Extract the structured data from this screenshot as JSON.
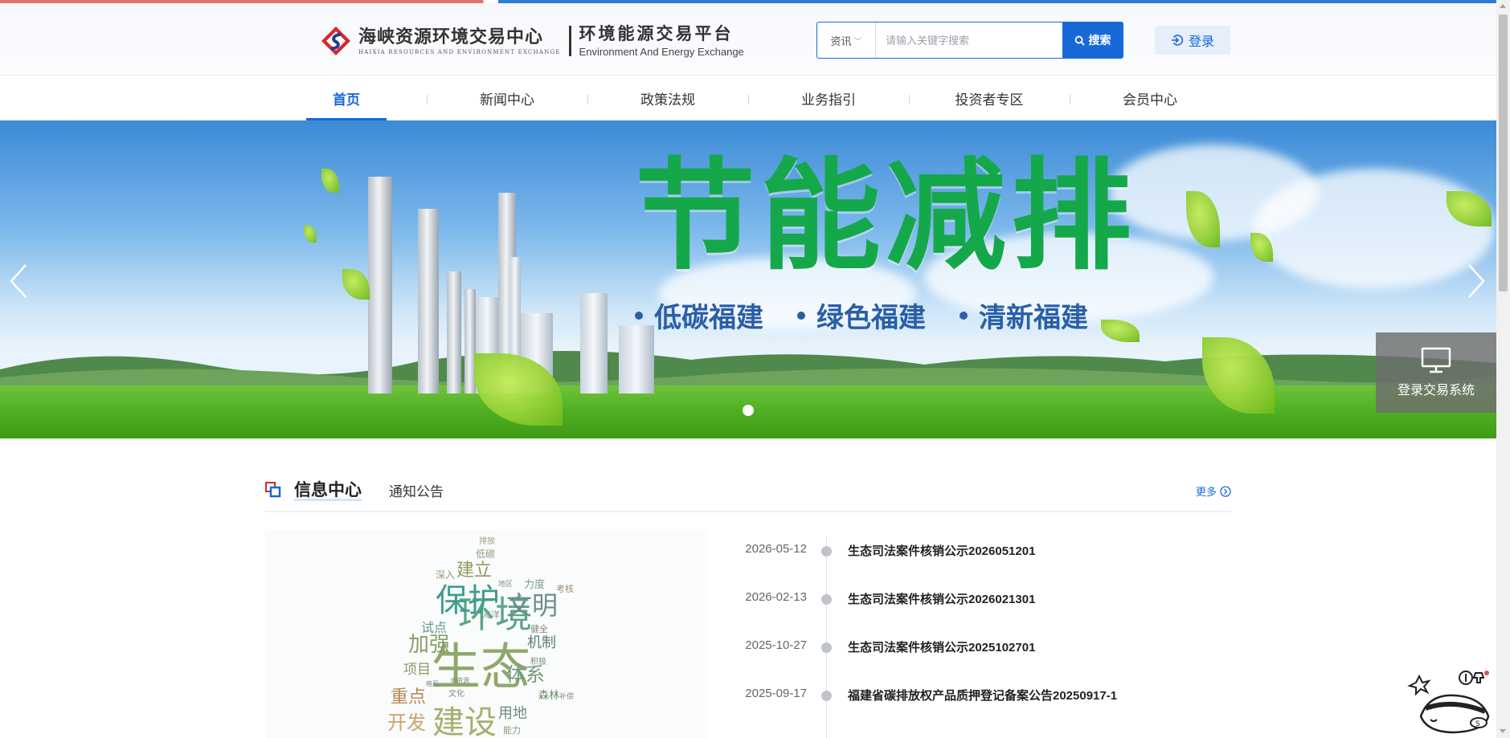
{
  "header": {
    "logo_cn": "海峡资源环境交易中心",
    "logo_en": "HAIXIA RESOURCES AND ENVIRONMENT EXCHANGE",
    "platform_cn": "环境能源交易平台",
    "platform_en": "Environment And Energy Exchange",
    "search": {
      "type_label": "资讯",
      "placeholder": "请输入关键字搜索",
      "button_label": "搜索"
    },
    "login_label": "登录"
  },
  "nav": {
    "items": [
      {
        "label": "首页",
        "active": true
      },
      {
        "label": "新闻中心"
      },
      {
        "label": "政策法规"
      },
      {
        "label": "业务指引"
      },
      {
        "label": "投资者专区"
      },
      {
        "label": "会员中心"
      }
    ]
  },
  "banner": {
    "title": "节能减排",
    "tags": [
      "低碳福建",
      "绿色福建",
      "清新福建"
    ],
    "prev_icon": "chevron-left-icon",
    "next_icon": "chevron-right-icon",
    "slide_count": 1,
    "system_login_label": "登录交易系统"
  },
  "info": {
    "title": "信息中心",
    "tab": "通知公告",
    "more_label": "更多",
    "news": [
      {
        "date": "2026-05-12",
        "title": "生态司法案件核销公示2026051201"
      },
      {
        "date": "2026-02-13",
        "title": "生态司法案件核销公示2026021301"
      },
      {
        "date": "2025-10-27",
        "title": "生态司法案件核销公示2025102701"
      },
      {
        "date": "2025-09-17",
        "title": "福建省碳排放权产品质押登记备案公告20250917-1"
      }
    ],
    "wordcloud": [
      "生态",
      "环境",
      "保护",
      "建设",
      "文明",
      "加强",
      "体系",
      "建立",
      "机制",
      "开发",
      "重点",
      "项目",
      "试点",
      "用地",
      "森林",
      "排放",
      "低碳",
      "深入",
      "力度",
      "考核",
      "海洋",
      "地区",
      "健全",
      "积极",
      "能力",
      "文化",
      "补偿",
      "水资源",
      "格局"
    ]
  },
  "colors": {
    "accent": "#1769d8",
    "banner_title": "#15a84a",
    "banner_tag": "#2a5ea8"
  }
}
